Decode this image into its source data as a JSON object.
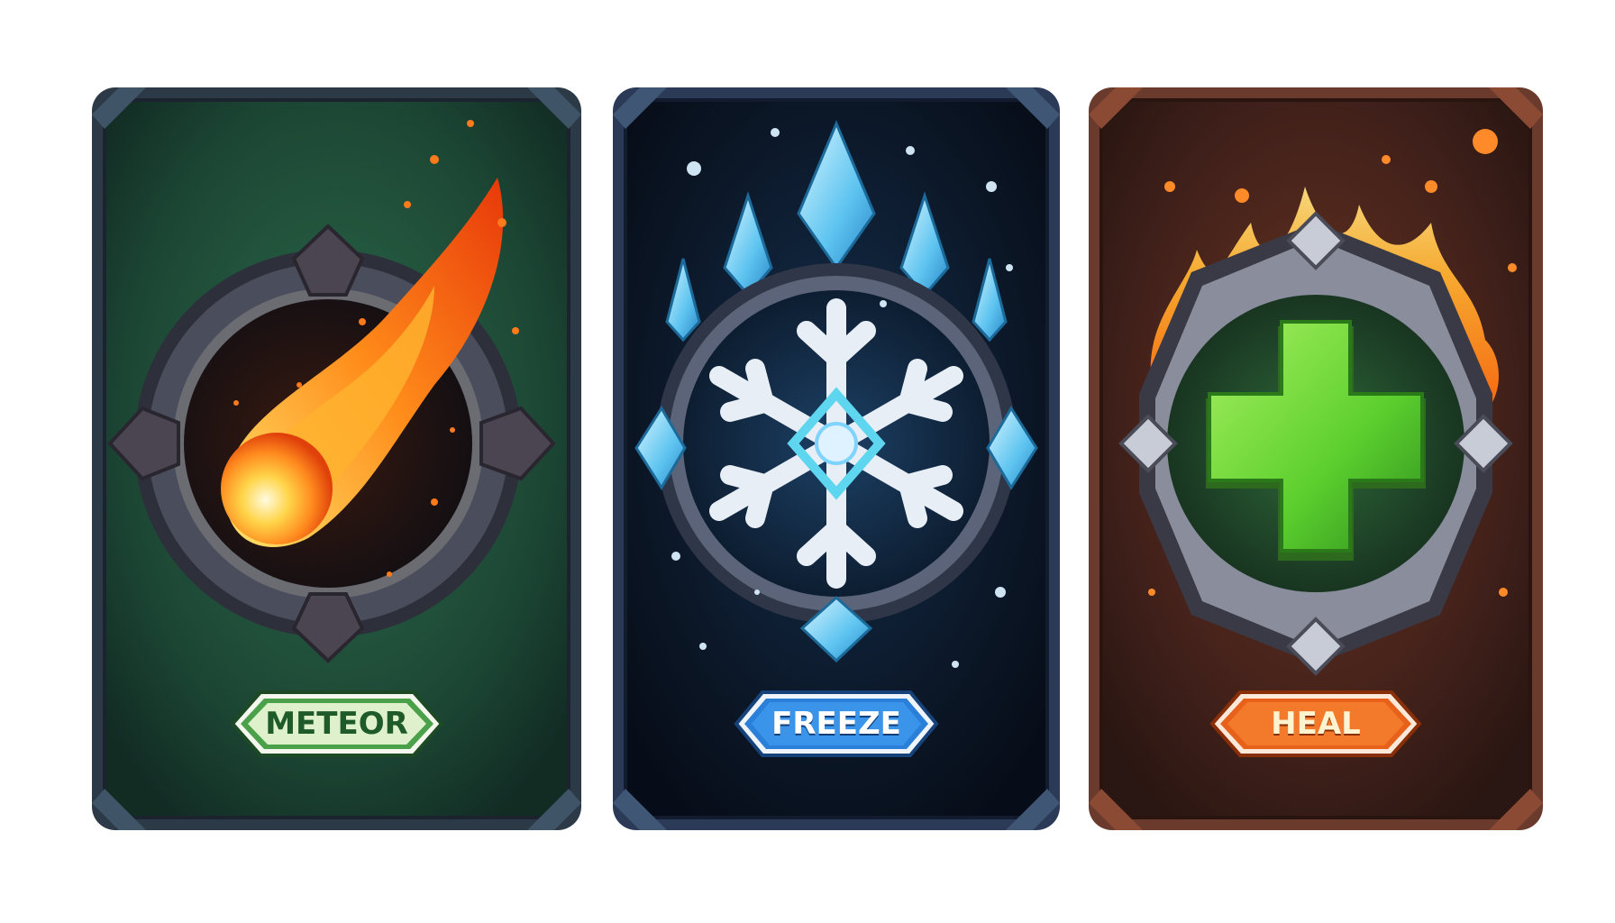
{
  "cards": [
    {
      "id": "meteor",
      "label": "METEOR",
      "icon": "meteor-icon",
      "theme": {
        "bg": "#1f4a36",
        "frame": "#2b3a4a",
        "accent": "#f7931e",
        "label_bg": "#3a8a3a"
      }
    },
    {
      "id": "freeze",
      "label": "FREEZE",
      "icon": "snowflake-icon",
      "theme": {
        "bg": "#0d1b2e",
        "frame": "#2d3f5c",
        "accent": "#7fd3ff",
        "label_bg": "#2a7fd8"
      }
    },
    {
      "id": "heal",
      "label": "HEAL",
      "icon": "green-cross-icon",
      "theme": {
        "bg": "#4a2418",
        "frame": "#6b3a2a",
        "accent": "#5fd13a",
        "label_bg": "#e8611a"
      }
    }
  ]
}
